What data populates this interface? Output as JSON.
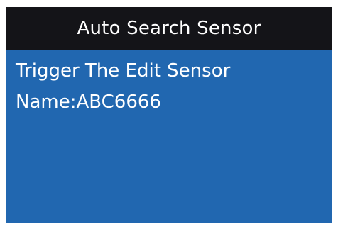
{
  "header": {
    "title": "Auto Search Sensor"
  },
  "message": {
    "instruction": "Trigger The Edit Sensor",
    "sensor_name": "Name:ABC6666"
  },
  "colors": {
    "background": "#2167b0",
    "title_bar": "#141418",
    "text": "#ffffff"
  }
}
